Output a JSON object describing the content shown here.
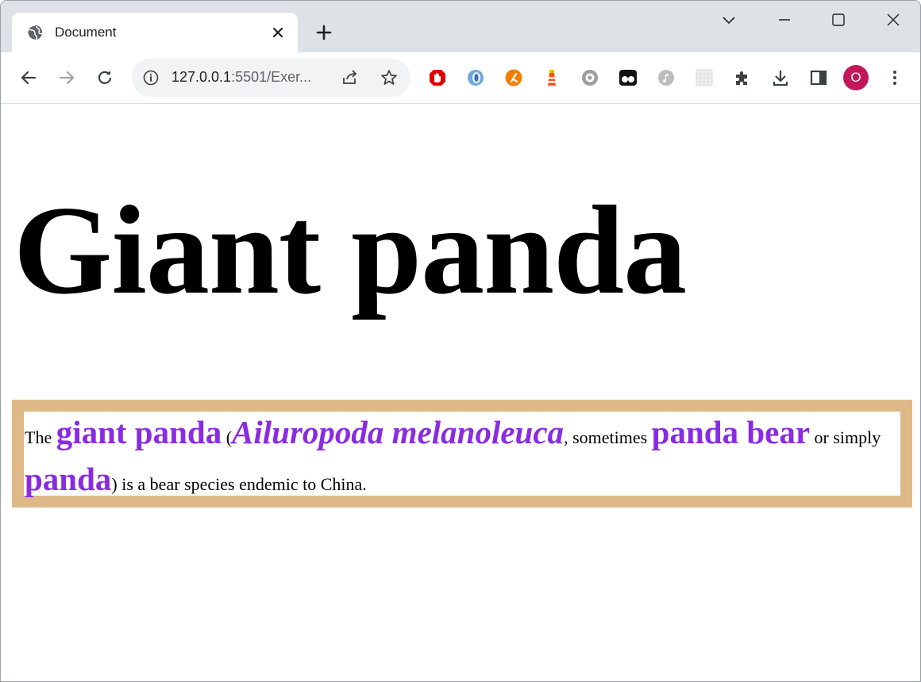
{
  "browser": {
    "tab_title": "Document",
    "url_host": "127.0.0.1",
    "url_rest": ":5501/Exer...",
    "profile_initial": "O"
  },
  "icons": {
    "tab": [
      "globe-icon",
      "close-icon",
      "plus-icon"
    ],
    "window": [
      "chevron-down-icon",
      "minimize-icon",
      "maximize-icon",
      "window-close-icon"
    ],
    "nav": [
      "back-arrow-icon",
      "forward-arrow-icon",
      "reload-icon",
      "info-icon",
      "share-icon",
      "star-icon"
    ],
    "extensions": [
      "ublock-icon",
      "ext-blue-icon",
      "ext-orange-icon",
      "ext-lighthouse-icon",
      "ext-gear-icon",
      "ext-glasses-icon",
      "ext-music-icon",
      "ext-grid-icon",
      "puzzle-icon",
      "download-icon",
      "side-panel-icon"
    ],
    "menu": "kebab-menu-icon"
  },
  "colors": {
    "highlight": "#8a2be2",
    "box_border": "#deb887",
    "avatar": "#c2185b"
  },
  "page": {
    "heading": "Giant panda",
    "para": {
      "t1": "The ",
      "giant_panda": "giant panda",
      "t2": " (",
      "scientific": "Ailuropoda melanoleuca",
      "t3": ", sometimes ",
      "panda_bear": "panda bear",
      "t4": " or simply ",
      "panda": "panda",
      "t5": ") is a bear species endemic to China."
    }
  }
}
